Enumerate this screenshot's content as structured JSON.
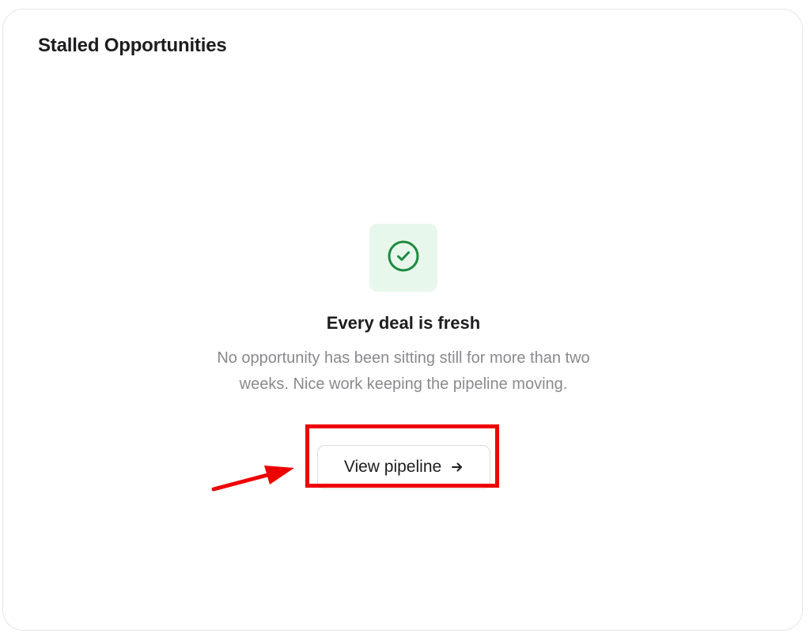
{
  "card": {
    "title": "Stalled Opportunities"
  },
  "empty_state": {
    "icon": "check-circle-icon",
    "title": "Every deal is fresh",
    "description": "No opportunity has been sitting still for more than two weeks. Nice work keeping the pipeline moving."
  },
  "action": {
    "label": "View pipeline",
    "icon": "arrow-right-icon"
  },
  "annotation": {
    "highlight_color": "#ee0000",
    "target": "view-pipeline-button"
  },
  "colors": {
    "success_icon": "#1f8a3d",
    "success_bg": "#e7f7ec",
    "muted_text": "#8a8a8e"
  }
}
